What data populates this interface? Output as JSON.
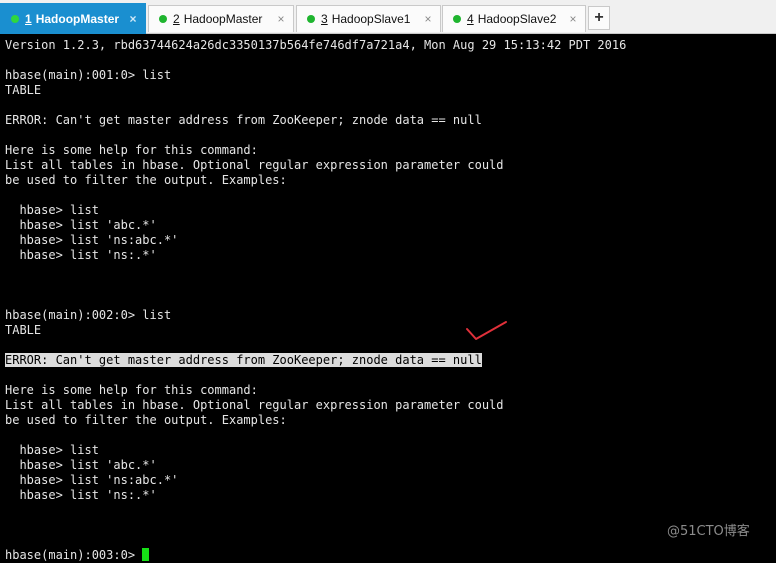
{
  "tabs": [
    {
      "num": "1",
      "label": "HadoopMaster",
      "active": true
    },
    {
      "num": "2",
      "label": "HadoopMaster",
      "active": false
    },
    {
      "num": "3",
      "label": "HadoopSlave1",
      "active": false
    },
    {
      "num": "4",
      "label": "HadoopSlave2",
      "active": false
    }
  ],
  "new_tab_label": "+",
  "close_glyph": "×",
  "terminal": {
    "lines": [
      "Version 1.2.3, rbd63744624a26dc3350137b564fe746df7a721a4, Mon Aug 29 15:13:42 PDT 2016",
      "",
      "hbase(main):001:0> list",
      "TABLE",
      "",
      "ERROR: Can't get master address from ZooKeeper; znode data == null",
      "",
      "Here is some help for this command:",
      "List all tables in hbase. Optional regular expression parameter could",
      "be used to filter the output. Examples:",
      "",
      "  hbase> list",
      "  hbase> list 'abc.*'",
      "  hbase> list 'ns:abc.*'",
      "  hbase> list 'ns:.*'",
      "",
      "",
      "",
      "hbase(main):002:0> list",
      "TABLE",
      "",
      "ERROR: Can't get master address from ZooKeeper; znode data == null",
      "",
      "Here is some help for this command:",
      "List all tables in hbase. Optional regular expression parameter could",
      "be used to filter the output. Examples:",
      "",
      "  hbase> list",
      "  hbase> list 'abc.*'",
      "  hbase> list 'ns:abc.*'",
      "  hbase> list 'ns:.*'",
      "",
      "",
      "",
      "hbase(main):003:0> "
    ],
    "highlighted_line": 21,
    "cursor_color": "#16e016"
  },
  "colors": {
    "active_tab": "#1a8fd0",
    "session_dot": "#1fb52f",
    "highlight": "#dcdcdc",
    "annotation_mark": "#e0303a"
  },
  "watermark": "@51CTO博客"
}
